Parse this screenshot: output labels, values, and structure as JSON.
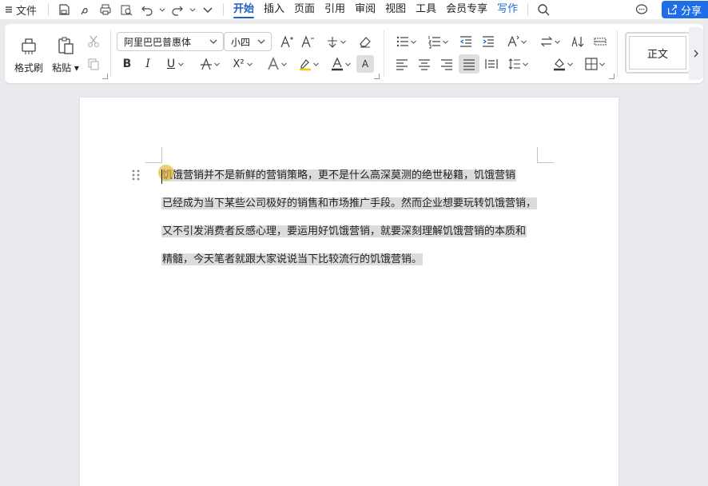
{
  "menubar": {
    "file_label": "文件",
    "tabs": [
      {
        "label": "开始"
      },
      {
        "label": "插入"
      },
      {
        "label": "页面"
      },
      {
        "label": "引用"
      },
      {
        "label": "审阅"
      },
      {
        "label": "视图"
      },
      {
        "label": "工具"
      },
      {
        "label": "会员专享"
      },
      {
        "label": "写作"
      }
    ],
    "share_label": "分享"
  },
  "ribbon": {
    "format_painter_label": "格式刷",
    "paste_label": "粘贴",
    "font_name": "阿里巴巴普惠体",
    "font_size": "小四",
    "style_label": "正文",
    "buttons": {
      "bold": "B",
      "italic": "I",
      "underline": "U",
      "superscript": "X²",
      "char_shading": "A"
    }
  },
  "document": {
    "lines": [
      "饥饿营销并不是新鲜的营销策略，更不是什么高深莫测的绝世秘籍，饥饿营销",
      "已经成为当下某些公司极好的销售和市场推广手段。然而企业想要玩转饥饿营销，",
      "又不引发消费者反感心理，要运用好饥饿营销，就要深刻理解饥饿营销的本质和",
      "精髓，今天笔者就跟大家说说当下比较流行的饥饿营销。"
    ]
  },
  "colors": {
    "accent": "#1f5fc8",
    "share_bg": "#1f6ee8",
    "selection": "#dcdcdc"
  }
}
